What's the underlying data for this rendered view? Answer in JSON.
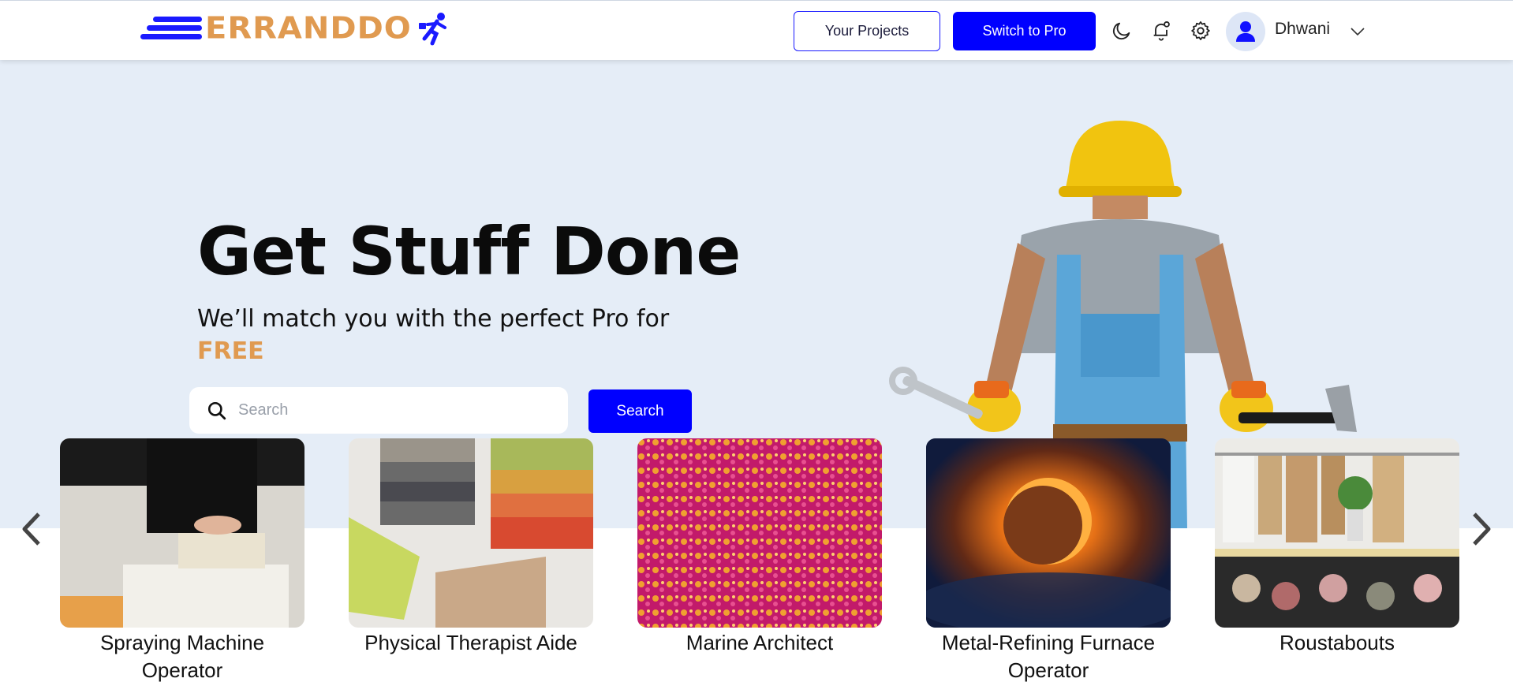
{
  "header": {
    "brand": "ERRANDDO",
    "your_projects": "Your Projects",
    "switch_pro": "Switch to Pro",
    "username": "Dhwani",
    "icons": [
      "moon-icon",
      "bell-icon",
      "gear-icon",
      "user-icon",
      "chevron-down-icon"
    ]
  },
  "hero": {
    "title": "Get Stuff Done",
    "subtitle_prefix": "We’ll match you with the perfect Pro for",
    "subtitle_highlight": "FREE",
    "search_placeholder": "Search",
    "search_button": "Search"
  },
  "colors": {
    "brand_blue": "#0000ff",
    "brand_orange": "#e09a50",
    "hero_bg": "#e5edf7"
  },
  "carousel": {
    "cards": [
      {
        "label": "Spraying Machine Operator"
      },
      {
        "label": "Physical Therapist Aide"
      },
      {
        "label": "Marine Architect"
      },
      {
        "label": "Metal-Refining Furnace Operator"
      },
      {
        "label": "Roustabouts"
      }
    ]
  }
}
